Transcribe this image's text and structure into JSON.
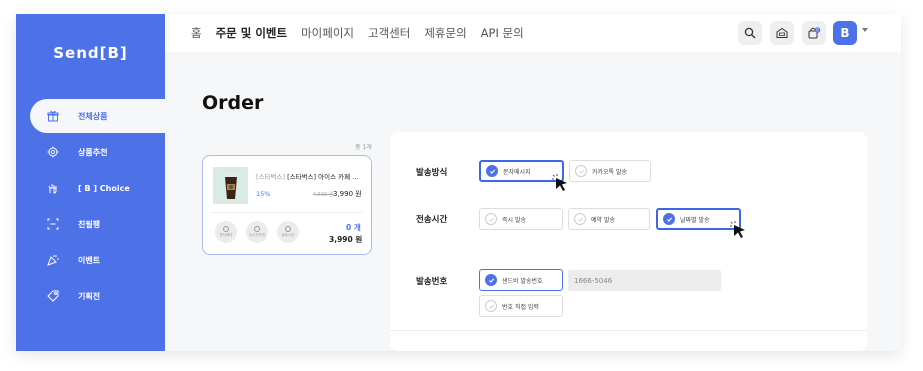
{
  "logo": "Send[B]",
  "sidebar": {
    "items": [
      {
        "label": "전체상품",
        "icon": "gift-icon",
        "active": true
      },
      {
        "label": "상품추천",
        "icon": "badge-icon",
        "active": false
      },
      {
        "label": "[ B ] Choice",
        "icon": "hand-icon",
        "active": false
      },
      {
        "label": "친필팽",
        "icon": "scan-icon",
        "active": false
      },
      {
        "label": "이벤트",
        "icon": "party-icon",
        "active": false
      },
      {
        "label": "기획전",
        "icon": "tag-icon",
        "active": false
      }
    ]
  },
  "topnav": {
    "items": [
      "홈",
      "주문 및 이벤트",
      "마이페이지",
      "고객센터",
      "제휴문의",
      "API 문의"
    ],
    "active": "주문 및 이벤트",
    "cart_badge": "0",
    "avatar": "B"
  },
  "page_title": "Order",
  "cart": {
    "count": "총 1개",
    "product": {
      "brand": "[스타벅스]",
      "name": "[스타벅스] 아이스 카페 ...",
      "discount": "15%",
      "original_price": "4,590 원",
      "price": "3,990 원",
      "actions": [
        "문자예약",
        "수신자변경",
        "발송시간"
      ],
      "quantity": "0 개",
      "total": "3,990 원"
    }
  },
  "options": {
    "method": {
      "label": "발송방식",
      "choices": [
        {
          "label": "문자메시지",
          "selected": true
        },
        {
          "label": "카카오톡 발송",
          "selected": false
        }
      ]
    },
    "time": {
      "label": "전송시간",
      "choices": [
        {
          "label": "즉시 발송",
          "selected": false
        },
        {
          "label": "예약 발송",
          "selected": false
        },
        {
          "label": "날짜별 발송",
          "selected": true
        }
      ]
    },
    "number": {
      "label": "발송번호",
      "choices": [
        {
          "label": "샌드비 발송번호",
          "selected": true
        },
        {
          "label": "번호 직접 입력",
          "selected": false
        }
      ],
      "phone_value": "1666-5046"
    }
  },
  "colors": {
    "accent": "#4d72e8",
    "bg": "#f6f7f9"
  }
}
